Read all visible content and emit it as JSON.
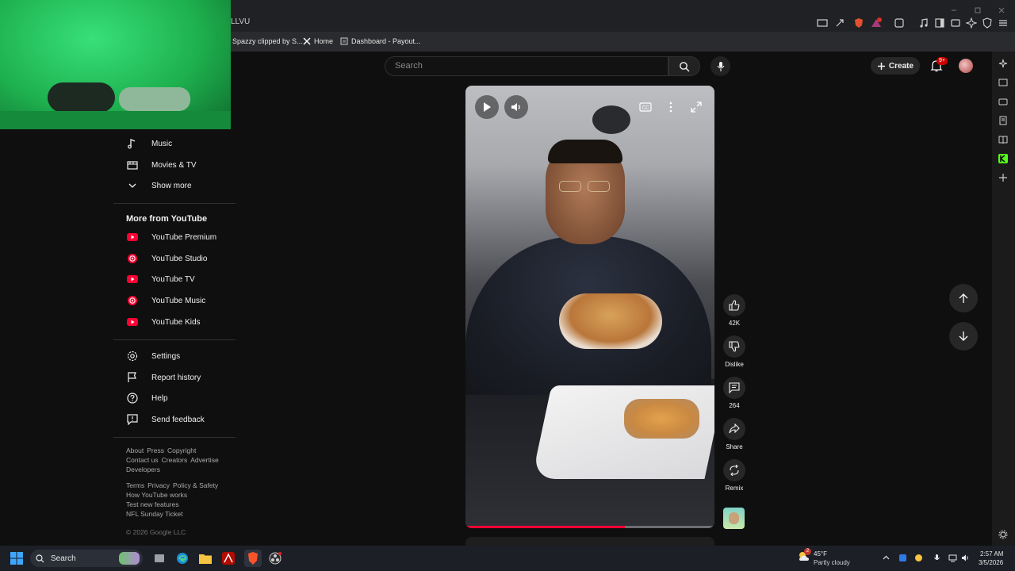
{
  "browser": {
    "tab_title": "LLVU",
    "bookmarks": [
      {
        "label": "Spazzy clipped by S..."
      },
      {
        "label": "Home"
      },
      {
        "label": "Dashboard - Payout..."
      }
    ]
  },
  "header": {
    "search_placeholder": "Search",
    "create_label": "Create",
    "notifications_badge": "9+"
  },
  "sidebar": {
    "explore_items": [
      {
        "label": "Music",
        "icon": "music-note-icon"
      },
      {
        "label": "Movies & TV",
        "icon": "clapperboard-icon"
      },
      {
        "label": "Show more",
        "icon": "chevron-down-icon"
      }
    ],
    "more_heading": "More from YouTube",
    "more_items": [
      {
        "label": "YouTube Premium"
      },
      {
        "label": "YouTube Studio"
      },
      {
        "label": "YouTube TV"
      },
      {
        "label": "YouTube Music"
      },
      {
        "label": "YouTube Kids"
      }
    ],
    "settings_items": [
      {
        "label": "Settings",
        "icon": "gear-icon"
      },
      {
        "label": "Report history",
        "icon": "flag-icon"
      },
      {
        "label": "Help",
        "icon": "help-icon"
      },
      {
        "label": "Send feedback",
        "icon": "feedback-icon"
      }
    ],
    "footer_row1": [
      "About",
      "Press",
      "Copyright",
      "Contact us",
      "Creators",
      "Advertise",
      "Developers"
    ],
    "footer_row2": [
      "Terms",
      "Privacy",
      "Policy & Safety",
      "How YouTube works",
      "Test new features",
      "NFL Sunday Ticket"
    ],
    "copyright": "© 2026 Google LLC"
  },
  "short": {
    "likes": "42K",
    "dislike_label": "Dislike",
    "comments": "264",
    "share_label": "Share",
    "remix_label": "Remix",
    "progress": 0.64
  },
  "taskbar": {
    "search_label": "Search",
    "temperature": "45°F",
    "weather": "Partly cloudy",
    "time": "2:57 AM",
    "date": "3/5/2026",
    "weather_badge": "2"
  },
  "colors": {
    "youtube_red": "#ff0033",
    "background": "#0f0f0f",
    "accent_blue": "#3ea6ff"
  }
}
